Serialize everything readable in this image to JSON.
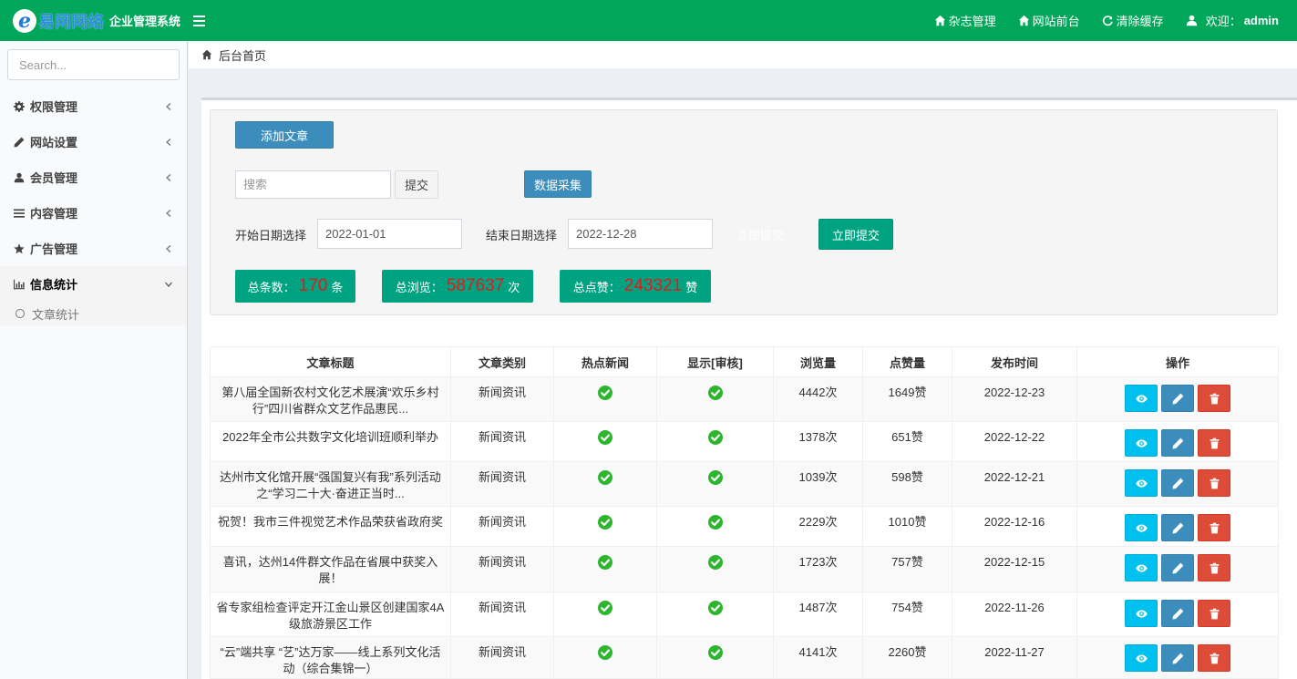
{
  "header": {
    "brand": "易网网络",
    "system_name": "企业管理系统",
    "nav": [
      {
        "label": "杂志管理",
        "icon": "home-icon"
      },
      {
        "label": "网站前台",
        "icon": "home-icon"
      },
      {
        "label": "清除缓存",
        "icon": "refresh-icon"
      }
    ],
    "welcome_label": "欢迎：",
    "username": "admin"
  },
  "sidebar": {
    "search_placeholder": "Search...",
    "menu": [
      {
        "label": "权限管理",
        "icon": "gear-icon"
      },
      {
        "label": "网站设置",
        "icon": "pencil-icon"
      },
      {
        "label": "会员管理",
        "icon": "user-icon"
      },
      {
        "label": "内容管理",
        "icon": "list-icon"
      },
      {
        "label": "广告管理",
        "icon": "star-icon"
      },
      {
        "label": "信息统计",
        "icon": "bar-chart-icon"
      }
    ],
    "submenu": "文章统计"
  },
  "breadcrumb": "后台首页",
  "toolbar": {
    "add_label": "添加文章",
    "search_placeholder": "搜索",
    "submit_label": "提交",
    "collect_label": "数据采集",
    "start_date_label": "开始日期选择",
    "start_date": "2022-01-01",
    "end_date_label": "结束日期选择",
    "end_date": "2022-12-28",
    "faint_label": "立即提交",
    "submit_now_label": "立即提交"
  },
  "stats": [
    {
      "prefix": "总条数：",
      "value": "170",
      "suffix": "条"
    },
    {
      "prefix": "总浏览：",
      "value": "587637",
      "suffix": "次"
    },
    {
      "prefix": "总点赞：",
      "value": "243321",
      "suffix": "赞"
    }
  ],
  "table": {
    "headers": [
      "文章标题",
      "文章类别",
      "热点新闻",
      "显示[审核]",
      "浏览量",
      "点赞量",
      "发布时间",
      "操作"
    ],
    "rows": [
      {
        "title": "第八届全国新农村文化艺术展演“欢乐乡村行”四川省群众文艺作品惠民...",
        "category": "新闻资讯",
        "views": "4442次",
        "likes": "1649赞",
        "date": "2022-12-23"
      },
      {
        "title": "2022年全市公共数字文化培训班顺利举办",
        "category": "新闻资讯",
        "views": "1378次",
        "likes": "651赞",
        "date": "2022-12-22"
      },
      {
        "title": "达州市文化馆开展“强国复兴有我”系列活动之“学习二十大·奋进正当时...",
        "category": "新闻资讯",
        "views": "1039次",
        "likes": "598赞",
        "date": "2022-12-21"
      },
      {
        "title": "祝贺！我市三件视觉艺术作品荣获省政府奖",
        "category": "新闻资讯",
        "views": "2229次",
        "likes": "1010赞",
        "date": "2022-12-16"
      },
      {
        "title": "喜讯，达州14件群文作品在省展中获奖入展！",
        "category": "新闻资讯",
        "views": "1723次",
        "likes": "757赞",
        "date": "2022-12-15"
      },
      {
        "title": "省专家组检查评定开江金山景区创建国家4A级旅游景区工作",
        "category": "新闻资讯",
        "views": "1487次",
        "likes": "754赞",
        "date": "2022-11-26"
      },
      {
        "title": "“云”端共享 “艺”达万家——线上系列文化活动（综合集锦一）",
        "category": "新闻资讯",
        "views": "4141次",
        "likes": "2260赞",
        "date": "2022-11-27"
      }
    ]
  }
}
